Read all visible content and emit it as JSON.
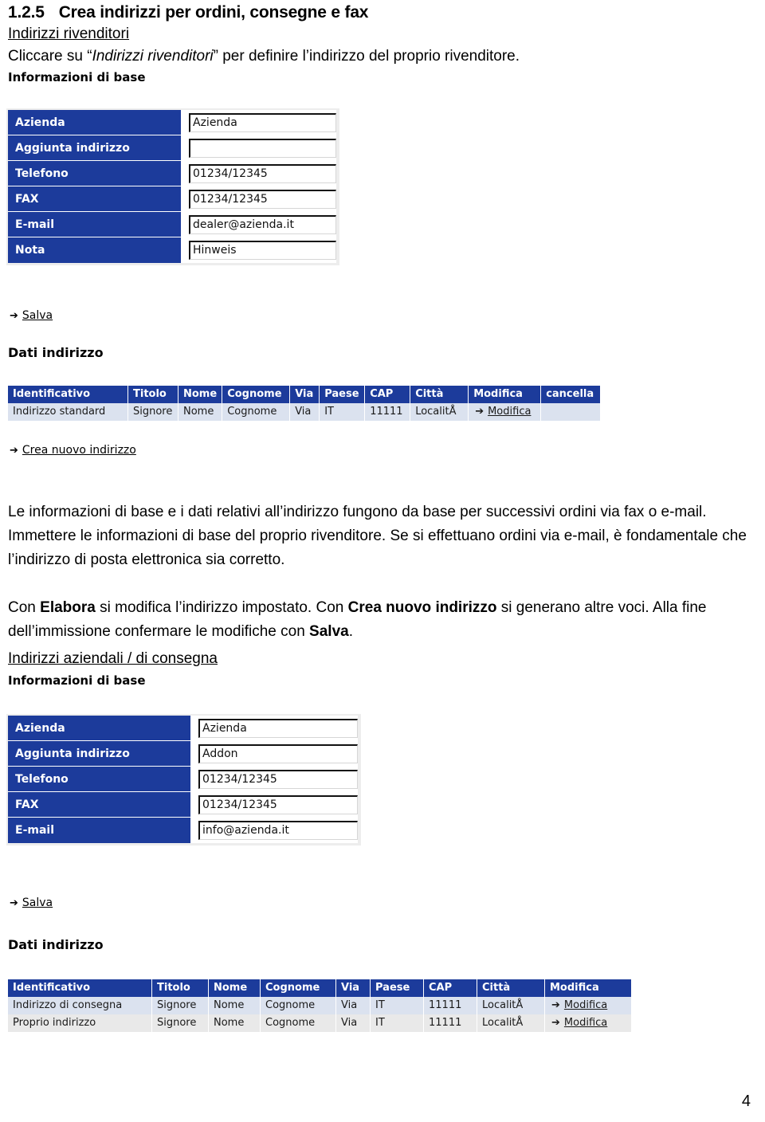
{
  "document": {
    "section_number": "1.2.5",
    "section_title": "Crea indirizzi per ordini, consegne e fax",
    "page_number": "4"
  },
  "colors": {
    "header_blue": "#1c3b9b",
    "row_odd": "#dbe2ef",
    "row_even": "#e9e9e9",
    "field_chrome": "#ededed"
  },
  "dealer_section": {
    "subhead": "Indirizzi rivenditori",
    "intro_prefix": "Cliccare su “",
    "intro_italic": "Indirizzi rivenditori",
    "intro_suffix": "” per definire l’indirizzo del proprio rivenditore.",
    "shot": {
      "title": "Informazioni di base",
      "fields": [
        {
          "label": "Azienda",
          "value": "Azienda"
        },
        {
          "label": "Aggiunta indirizzo",
          "value": ""
        },
        {
          "label": "Telefono",
          "value": "01234/12345"
        },
        {
          "label": "FAX",
          "value": "01234/12345"
        },
        {
          "label": "E-mail",
          "value": "dealer@azienda.it"
        },
        {
          "label": "Nota",
          "value": "Hinweis"
        }
      ],
      "save_link": "Salva",
      "grid_title": "Dati indirizzo",
      "grid_headers": [
        "Identificativo",
        "Titolo",
        "Nome",
        "Cognome",
        "Via",
        "Paese",
        "CAP",
        "Città",
        "Modifica",
        "cancella"
      ],
      "grid_rows": [
        {
          "cells": [
            "Indirizzo standard",
            "Signore",
            "Nome",
            "Cognome",
            "Via",
            "IT",
            "11111",
            "LocalitÅ"
          ],
          "modifica": "Modifica",
          "cancella": ""
        }
      ],
      "new_link": "Crea nuovo indirizzo"
    }
  },
  "body_text": {
    "paragraph_1": [
      {
        "t": "Le informazioni di base e i dati relativi all’indirizzo fungono da base per successivi ordini via fax o e-mail. Immettere le informazioni di base del proprio rivenditore. Se si effettuano ordini via e-mail, è fondamentale che l’indirizzo di posta elettronica sia corretto.",
        "b": false
      }
    ],
    "paragraph_2": [
      {
        "t": "Con ",
        "b": false
      },
      {
        "t": "Elabora",
        "b": true
      },
      {
        "t": " si modifica l’indirizzo impostato. Con ",
        "b": false
      },
      {
        "t": "Crea nuovo indirizzo",
        "b": true
      },
      {
        "t": " si generano altre voci. Alla fine dell’immissione confermare le modifiche con ",
        "b": false
      },
      {
        "t": "Salva",
        "b": true
      },
      {
        "t": ".",
        "b": false
      }
    ]
  },
  "company_section": {
    "subhead": "Indirizzi aziendali / di consegna",
    "shot": {
      "title": "Informazioni di base",
      "fields": [
        {
          "label": "Azienda",
          "value": "Azienda"
        },
        {
          "label": "Aggiunta indirizzo",
          "value": "Addon"
        },
        {
          "label": "Telefono",
          "value": "01234/12345"
        },
        {
          "label": "FAX",
          "value": "01234/12345"
        },
        {
          "label": "E-mail",
          "value": "info@azienda.it"
        }
      ],
      "save_link": "Salva",
      "grid_title": "Dati indirizzo",
      "grid_headers": [
        "Identificativo",
        "Titolo",
        "Nome",
        "Cognome",
        "Via",
        "Paese",
        "CAP",
        "Città",
        "Modifica"
      ],
      "grid_rows": [
        {
          "cells": [
            "Indirizzo di consegna",
            "Signore",
            "Nome",
            "Cognome",
            "Via",
            "IT",
            "11111",
            "LocalitÅ"
          ],
          "modifica": "Modifica"
        },
        {
          "cells": [
            "Proprio indirizzo",
            "Signore",
            "Nome",
            "Cognome",
            "Via",
            "IT",
            "11111",
            "LocalitÅ"
          ],
          "modifica": "Modifica"
        }
      ]
    }
  },
  "icons": {
    "arrow": "➔"
  }
}
